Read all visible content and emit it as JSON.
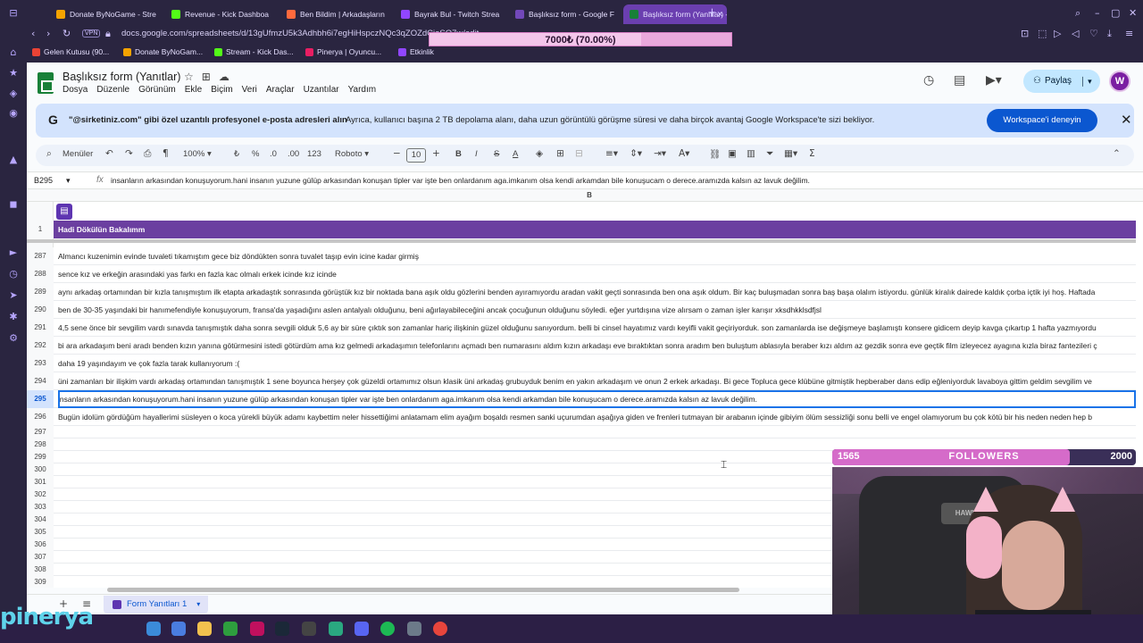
{
  "browser": {
    "tabs": [
      {
        "label": "Donate ByNoGame - Stre",
        "color": "#f4a300"
      },
      {
        "label": "Revenue - Kick Dashboa",
        "color": "#53fc18"
      },
      {
        "label": "Ben Bildim | Arkadaşların",
        "color": "#ff6a3d"
      },
      {
        "label": "Bayrak Bul - Twitch Strea",
        "color": "#9146ff"
      },
      {
        "label": "Başlıksız form - Google F",
        "color": "#7248b9"
      },
      {
        "label": "Başlıksız form (Yanıtlar) -",
        "color": "#188038"
      }
    ],
    "url": "docs.google.com/spreadsheets/d/13gUfmzU5k3Adhbh6i7egHiHspczNQc3qZOZdCjeSQ7w/edit",
    "vpn": "VPN",
    "bookmarks": [
      {
        "label": "Gelen Kutusu (90...",
        "color": "#ea4335"
      },
      {
        "label": "Donate ByNoGam...",
        "color": "#f4a300"
      },
      {
        "label": "Stream - Kick Das...",
        "color": "#53fc18"
      },
      {
        "label": "Pinerya | Oyuncu...",
        "color": "#e91e63"
      },
      {
        "label": "Etkinlik",
        "color": "#9146ff"
      }
    ]
  },
  "goal": {
    "text": "7000₺ (70.00%)",
    "percent": 70
  },
  "sheets": {
    "title": "Başlıksız form (Yanıtlar)",
    "menus": [
      "Dosya",
      "Düzenle",
      "Görünüm",
      "Ekle",
      "Biçim",
      "Veri",
      "Araçlar",
      "Uzantılar",
      "Yardım"
    ],
    "share": "Paylaş",
    "avatar": "W",
    "promo": {
      "g": "G",
      "bold": "\"@sirketiniz.com\" gibi özel uzantılı profesyonel e-posta adresleri alın",
      "text": "Ayrıca, kullanıcı başına 2 TB depolama alanı, daha uzun görüntülü görüşme süresi ve daha birçok avantaj Google Workspace'te sizi bekliyor.",
      "button": "Workspace'i deneyin"
    },
    "toolbar": {
      "menus": "Menüler",
      "zoom": "100%",
      "currency": "₺",
      "percent": "%",
      "dec_minus": ".0",
      "dec_plus": ".00",
      "number_format": "123",
      "font": "Roboto",
      "font_size": "10"
    },
    "name_box": "B295",
    "fx": "fx",
    "formula": "insanların arkasından konuşuyorum.hani insanın yuzune gülüp arkasından konuşan tipler var işte ben onlardanım aga.imkanım olsa kendi arkamdan bile konuşucam o derece.aramızda kalsın az lavuk değilim.",
    "column": "B",
    "rows": [
      {
        "n": "1",
        "text": "Hadi Dökülün Bakalımm"
      },
      {
        "n": "287",
        "text": "Almancı kuzenimin evinde tuvaleti tıkamıştım gece biz döndükten sonra tuvalet taşıp evin icine kadar girmiş"
      },
      {
        "n": "288",
        "text": "sence kız ve erkeğin arasındaki yas farkı en fazla kac olmalı erkek icinde kız icinde"
      },
      {
        "n": "289",
        "text": "aynı arkadaş ortamından bir kızla tanışmıştım ilk etapta arkadaştık sonrasında görüştük kız bir noktada bana aşık oldu gözlerini benden ayıramıyordu aradan vakit geçti sonrasında ben ona aşık oldum. Bir kaç buluşmadan sonra baş başa olalım istiyordu. günlük kiralık dairede kaldık çorba içtik iyi hoş. Haftada"
      },
      {
        "n": "290",
        "text": "ben de 30-35 yaşındaki bir hanımefendiyle konuşuyorum, fransa'da yaşadığını aslen antalyalı olduğunu, beni ağırlayabileceğini ancak çocuğunun olduğunu söyledi. eğer yurtdışına vize alırsam o zaman işler karışır xksdhkklsdfjsl"
      },
      {
        "n": "291",
        "text": "4,5 sene önce bir sevgilim vardı sınavda tanışmıştık daha sonra sevgili olduk 5,6 ay bir süre çıktık son zamanlar hariç ilişkinin güzel olduğunu sanıyordum. belli bi cinsel hayatımız vardı keyifli vakit geçiriyorduk. son zamanlarda ise değişmeye başlamıştı konsere gidicem deyip kavga çıkartıp 1 hafta yazmıyordu"
      },
      {
        "n": "292",
        "text": "bi ara arkadaşım beni aradı benden kızın yanına götürmesini istedi götürdüm ama kız gelmedi arkadaşımın telefonlarını açmadı ben numarasını aldım kızın arkadaşı eve bıraktıktan sonra aradım ben buluştum ablasıyla beraber kızı aldım az gezdik sonra eve geçtik film izleyecez ayagına kızla biraz fantezileri ç"
      },
      {
        "n": "293",
        "text": "daha 19 yaşındayım ve çok fazla tarak kullanıyorum :("
      },
      {
        "n": "294",
        "text": "üni zamanları bir ilişkim vardı arkadaş ortamından tanışmıştık 1 sene boyunca herşey çok güzeldi ortamımız olsun klasik üni arkadaş grubuyduk benim en yakın arkadaşım ve onun 2 erkek arkadaşı. Bi gece Topluca gece klübüne gitmiştik hepberaber dans edip eğleniyorduk lavaboya gittim geldim sevgilim ve"
      },
      {
        "n": "295",
        "text": "insanların arkasından konuşuyorum.hani insanın yuzune gülüp arkasından konuşan tipler var işte ben onlardanım aga.imkanım olsa kendi arkamdan bile konuşucam o derece.aramızda kalsın az lavuk değilim."
      },
      {
        "n": "296",
        "text": "Bugün idolüm gördüğüm hayallerimi süsleyen o koca yürekli büyük adamı kaybettim neler hissettiğimi anlatamam elim ayağım boşaldı resmen sanki uçurumdan aşağıya giden ve frenleri tutmayan bir arabanın içinde gibiyim ölüm sessizliği sonu belli ve engel olamıyorum bu çok kötü bir his neden neden hep b"
      }
    ],
    "empty_rows": [
      "297",
      "298",
      "299",
      "300",
      "301",
      "302",
      "303",
      "304",
      "305",
      "306",
      "307",
      "308",
      "309"
    ],
    "sheet_tab": "Form Yanıtları 1"
  },
  "followers": {
    "current": "1565",
    "label": "FOLLOWERS",
    "goal": "2000",
    "fraction": 0.7825
  },
  "stream_logo": "pinerya",
  "webcam_badge": "HAWK"
}
